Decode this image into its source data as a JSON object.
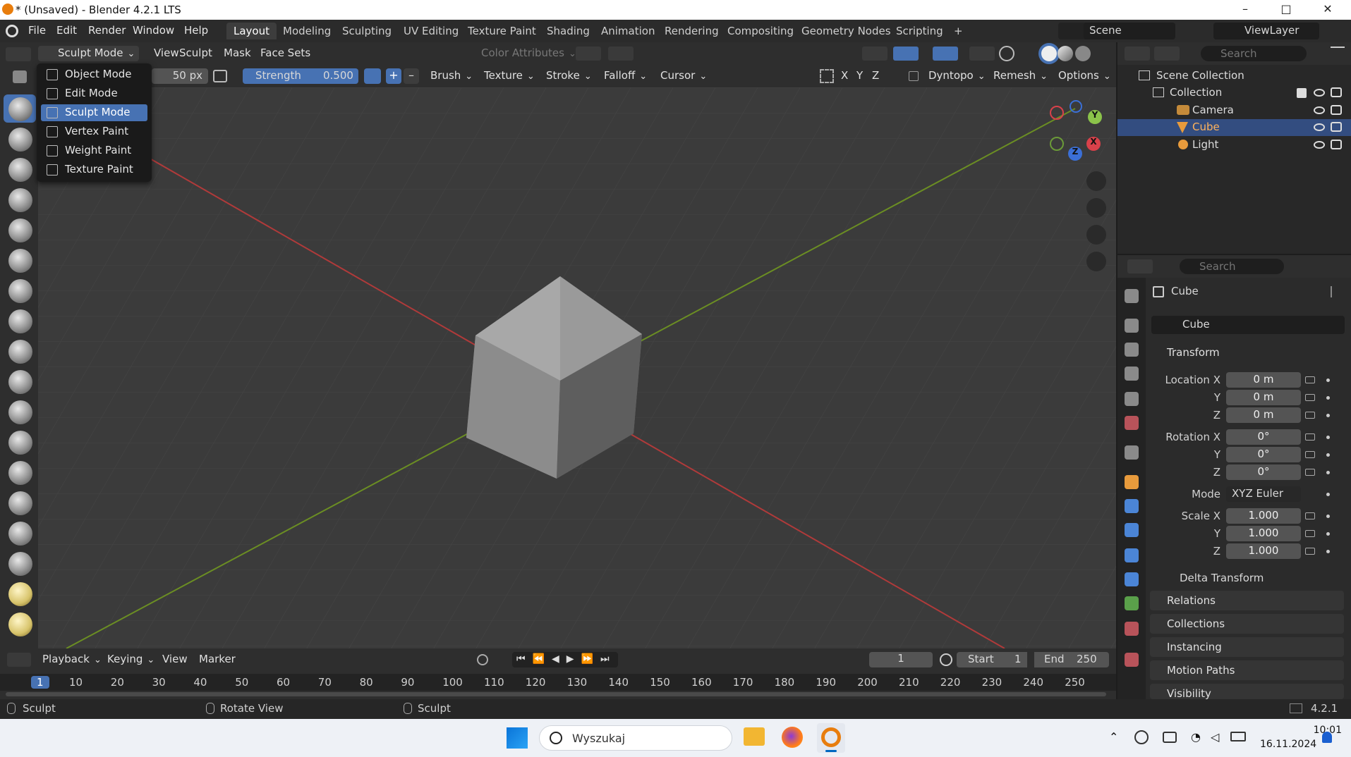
{
  "window": {
    "title": "* (Unsaved) - Blender 4.2.1 LTS",
    "minimize": "–",
    "maximize": "□",
    "close": "✕"
  },
  "menubar": {
    "items": [
      "File",
      "Edit",
      "Render",
      "Window",
      "Help"
    ],
    "tabs": [
      "Layout",
      "Modeling",
      "Sculpting",
      "UV Editing",
      "Texture Paint",
      "Shading",
      "Animation",
      "Rendering",
      "Compositing",
      "Geometry Nodes",
      "Scripting"
    ],
    "active_tab": "Layout",
    "add_tab": "+",
    "scene": "Scene",
    "view_layer": "ViewLayer"
  },
  "header1": {
    "mode": "Sculpt Mode",
    "menus": [
      "View",
      "Sculpt",
      "Mask",
      "Face Sets"
    ],
    "color_attributes": "Color Attributes"
  },
  "header2": {
    "radius": "50 px",
    "strength_label": "Strength",
    "strength_value": "0.500",
    "plus": "+",
    "minus": "–",
    "menus": [
      "Brush",
      "Texture",
      "Stroke",
      "Falloff",
      "Cursor"
    ],
    "axes": [
      "X",
      "Y",
      "Z"
    ],
    "dyntopo": "Dyntopo",
    "remesh": "Remesh",
    "options": "Options"
  },
  "mode_menu": {
    "items": [
      "Object Mode",
      "Edit Mode",
      "Sculpt Mode",
      "Vertex Paint",
      "Weight Paint",
      "Texture Paint"
    ],
    "selected": "Sculpt Mode"
  },
  "gizmo": {
    "x": "X",
    "y": "Y",
    "z": "Z"
  },
  "outliner": {
    "search_placeholder": "Search",
    "root": "Scene Collection",
    "collection": "Collection",
    "objects": [
      "Camera",
      "Cube",
      "Light"
    ],
    "selected": "Cube"
  },
  "properties": {
    "search_placeholder": "Search",
    "object_name": "Cube",
    "data_name": "Cube",
    "transform": "Transform",
    "location_label": "Location X",
    "rotation_label": "Rotation X",
    "scale_label": "Scale X",
    "y_label": "Y",
    "z_label": "Z",
    "location": [
      "0 m",
      "0 m",
      "0 m"
    ],
    "rotation": [
      "0°",
      "0°",
      "0°"
    ],
    "mode_label": "Mode",
    "mode_value": "XYZ Euler",
    "scale": [
      "1.000",
      "1.000",
      "1.000"
    ],
    "delta": "Delta Transform",
    "panels": [
      "Relations",
      "Collections",
      "Instancing",
      "Motion Paths",
      "Visibility"
    ]
  },
  "timeline": {
    "menus": [
      "Playback",
      "Keying",
      "View",
      "Marker"
    ],
    "current_frame": "1",
    "start_label": "Start",
    "start": "1",
    "end_label": "End",
    "end": "250",
    "ruler": [
      "1",
      "10",
      "20",
      "30",
      "40",
      "50",
      "60",
      "70",
      "80",
      "90",
      "100",
      "110",
      "120",
      "130",
      "140",
      "150",
      "160",
      "170",
      "180",
      "190",
      "200",
      "210",
      "220",
      "230",
      "240",
      "250"
    ]
  },
  "statusbar": {
    "left": "Sculpt",
    "middle": "Rotate View",
    "right": "Sculpt",
    "version": "4.2.1"
  },
  "taskbar": {
    "search_placeholder": "Wyszukaj",
    "time": "10:01",
    "date": "16.11.2024"
  }
}
